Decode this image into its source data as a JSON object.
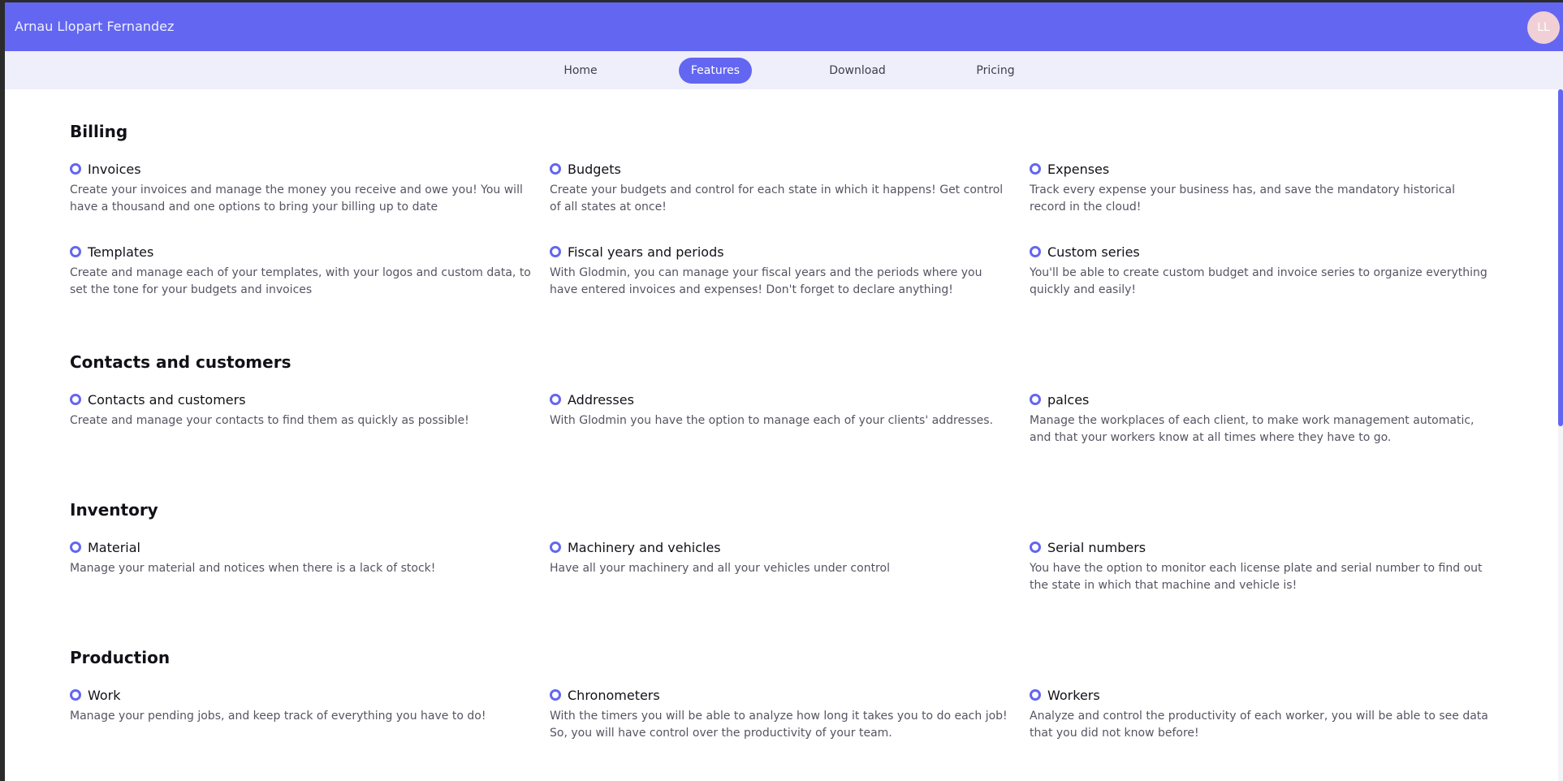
{
  "header": {
    "user_name": "Arnau Llopart Fernandez",
    "avatar_initials": "LL"
  },
  "nav": {
    "items": [
      {
        "label": "Home"
      },
      {
        "label": "Features"
      },
      {
        "label": "Download"
      },
      {
        "label": "Pricing"
      }
    ],
    "active": "Features"
  },
  "sections": [
    {
      "title": "Billing",
      "features": [
        {
          "title": "Invoices",
          "desc": "Create your invoices and manage the money you receive and owe you! You will have a thousand and one options to bring your billing up to date"
        },
        {
          "title": "Budgets",
          "desc": "Create your budgets and control for each state in which it happens! Get control of all states at once!"
        },
        {
          "title": "Expenses",
          "desc": "Track every expense your business has, and save the mandatory historical record in the cloud!"
        },
        {
          "title": "Templates",
          "desc": "Create and manage each of your templates, with your logos and custom data, to set the tone for your budgets and invoices"
        },
        {
          "title": "Fiscal years and periods",
          "desc": "With Glodmin, you can manage your fiscal years and the periods where you have entered invoices and expenses! Don't forget to declare anything!"
        },
        {
          "title": "Custom series",
          "desc": "You'll be able to create custom budget and invoice series to organize everything quickly and easily!"
        }
      ]
    },
    {
      "title": "Contacts and customers",
      "features": [
        {
          "title": "Contacts and customers",
          "desc": "Create and manage your contacts to find them as quickly as possible!"
        },
        {
          "title": "Addresses",
          "desc": "With Glodmin you have the option to manage each of your clients' addresses."
        },
        {
          "title": "palces",
          "desc": "Manage the workplaces of each client, to make work management automatic, and that your workers know at all times where they have to go."
        }
      ]
    },
    {
      "title": "Inventory",
      "features": [
        {
          "title": "Material",
          "desc": "Manage your material and notices when there is a lack of stock!"
        },
        {
          "title": "Machinery and vehicles",
          "desc": "Have all your machinery and all your vehicles under control"
        },
        {
          "title": "Serial numbers",
          "desc": "You have the option to monitor each license plate and serial number to find out the state in which that machine and vehicle is!"
        }
      ]
    },
    {
      "title": "Production",
      "features": [
        {
          "title": "Work",
          "desc": "Manage your pending jobs, and keep track of everything you have to do!"
        },
        {
          "title": "Chronometers",
          "desc": "With the timers you will be able to analyze how long it takes you to do each job! So, you will have control over the productivity of your team."
        },
        {
          "title": "Workers",
          "desc": "Analyze and control the productivity of each worker, you will be able to see data that you did not know before!"
        }
      ]
    }
  ],
  "colors": {
    "accent": "#6366f1",
    "nav_background": "#efeffb"
  }
}
